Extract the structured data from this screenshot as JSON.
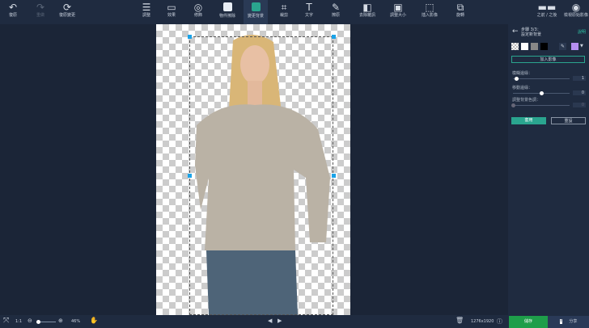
{
  "toolbar": {
    "undo": "復原",
    "redo": "重做",
    "reset_changes": "復原變更",
    "adjust": "調整",
    "effects": "效果",
    "retouch": "修飾",
    "object_erase": "物件擦除",
    "change_bg": "變更背景",
    "crop": "裁剪",
    "text": "文字",
    "clone": "擦原",
    "denoise": "去除雜訊",
    "resize": "調整大小",
    "insert_image": "插入影像",
    "rotate": "旋轉",
    "before_after": "之前 / 之後",
    "view_original": "檢視原始影像"
  },
  "panel": {
    "step": "步驟 3/3：",
    "subtitle": "設定新背景",
    "help": "說明",
    "add_image": "加入影像",
    "blur_edge_label": "模糊邊緣：",
    "blur_edge_value": "1",
    "blur_edge_fraction": 0.05,
    "move_edge_label": "移動邊緣：",
    "move_edge_value": "0",
    "move_edge_fraction": 0.5,
    "bg_tone_label": "調整背景色調：",
    "bg_tone_value": "0",
    "bg_tone_fraction": 0,
    "apply": "套用",
    "reset": "重設",
    "swatches": [
      "#ffffff",
      "#888888",
      "#000000"
    ],
    "picked_color": "#b48ef0"
  },
  "bottom": {
    "fit": "1:1",
    "zoom": "46%",
    "zoom_fraction": 0.05,
    "dimensions": "1276x1920",
    "save": "儲存",
    "share": "分享"
  },
  "colors": {
    "accent": "#2aa58f",
    "save": "#1e9e4a"
  }
}
